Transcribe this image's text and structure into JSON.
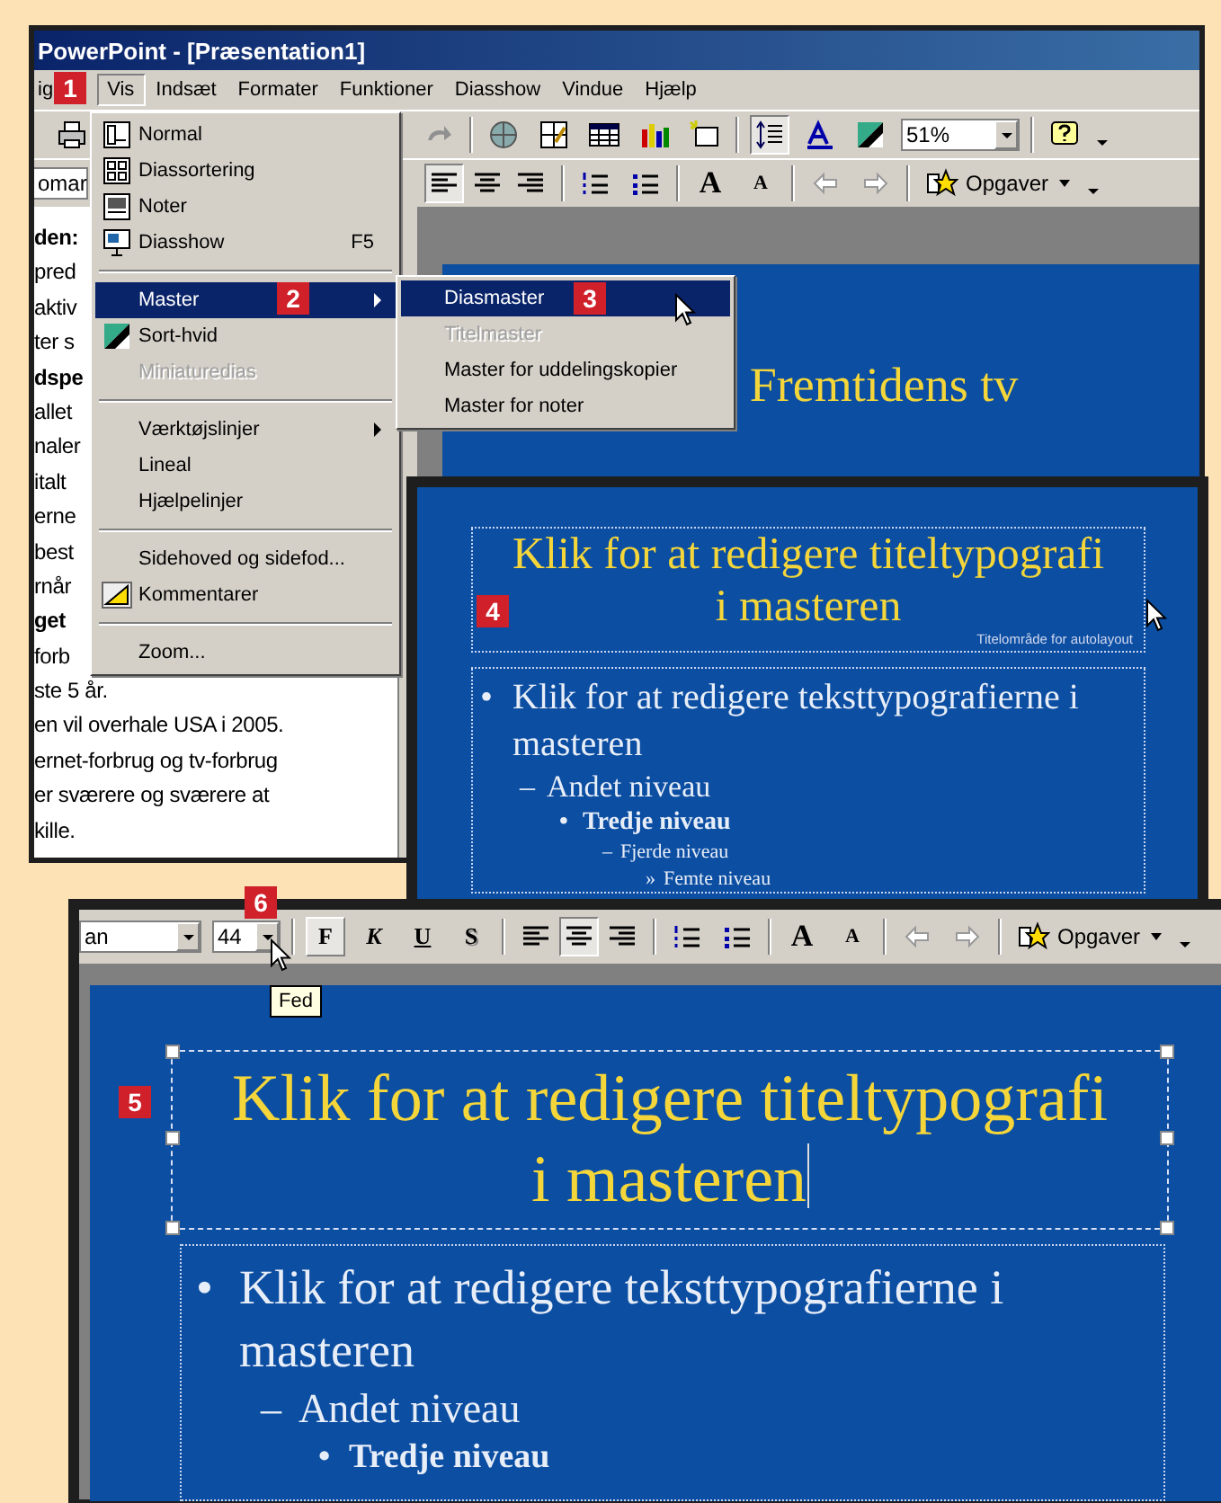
{
  "desktop_window": {
    "title": "PowerPoint - [Præsentation1]",
    "menu_bar": [
      {
        "label": "ig",
        "selected": false
      },
      {
        "label": "Vis",
        "selected": true
      },
      {
        "label": "Indsæt",
        "selected": false
      },
      {
        "label": "Formater",
        "selected": false
      },
      {
        "label": "Funktioner",
        "selected": false
      },
      {
        "label": "Diasshow",
        "selected": false
      },
      {
        "label": "Vindue",
        "selected": false
      },
      {
        "label": "Hjælp",
        "selected": false
      }
    ],
    "standard_toolbar": {
      "zoom": "51%"
    },
    "formatting_toolbar": {
      "font": "omar",
      "alignment": [
        {
          "selected": true
        },
        {
          "selected": false
        },
        {
          "selected": false
        }
      ],
      "grow_font": "A",
      "shrink_font": "A",
      "tasks": "Opgaver"
    },
    "outline_lines": [
      {
        "text": "den:",
        "kind": "bold"
      },
      {
        "text": "pred",
        "kind": "normal"
      },
      {
        "text": "aktiv",
        "kind": "normal"
      },
      {
        "text": "ter s",
        "kind": "normal"
      },
      {
        "text": "dspe",
        "kind": "bold"
      },
      {
        "text": "allet",
        "kind": "normal"
      },
      {
        "text": "naler",
        "kind": "normal"
      },
      {
        "text": "italt",
        "kind": "normal"
      },
      {
        "text": "erne",
        "kind": "normal"
      },
      {
        "text": "best",
        "kind": "normal"
      },
      {
        "text": "rnår",
        "kind": "normal"
      },
      {
        "text": "get",
        "kind": "bold"
      },
      {
        "text": "forb",
        "kind": "normal"
      },
      {
        "text": "ste 5 år.",
        "kind": "normal"
      },
      {
        "text": "en vil overhale USA i 2005.",
        "kind": "normal"
      },
      {
        "text": "ernet-forbrug og tv-forbrug",
        "kind": "normal"
      },
      {
        "text": "er sværere og sværere at",
        "kind": "normal"
      },
      {
        "text": "kille.",
        "kind": "normal"
      }
    ],
    "view_menu": [
      {
        "kind": "item",
        "label": "Normal",
        "selected": false,
        "disabled": false,
        "submenu": false
      },
      {
        "kind": "item",
        "label": "Diassortering",
        "selected": false,
        "disabled": false,
        "submenu": false
      },
      {
        "kind": "item",
        "label": "Noter",
        "selected": false,
        "disabled": false,
        "submenu": false
      },
      {
        "kind": "item",
        "label": "Diasshow",
        "shortcut": "F5",
        "selected": false,
        "disabled": false,
        "submenu": false
      },
      {
        "kind": "separator"
      },
      {
        "kind": "item",
        "label": "Master",
        "selected": true,
        "disabled": false,
        "submenu": true
      },
      {
        "kind": "item",
        "label": "Sort-hvid",
        "selected": false,
        "disabled": false,
        "submenu": false
      },
      {
        "kind": "item",
        "label": "Miniaturedias",
        "selected": false,
        "disabled": true,
        "submenu": false
      },
      {
        "kind": "separator"
      },
      {
        "kind": "item",
        "label": "Værktøjslinjer",
        "selected": false,
        "disabled": false,
        "submenu": true
      },
      {
        "kind": "item",
        "label": "Lineal",
        "selected": false,
        "disabled": false,
        "submenu": false
      },
      {
        "kind": "item",
        "label": "Hjælpelinjer",
        "selected": false,
        "disabled": false,
        "submenu": false
      },
      {
        "kind": "separator"
      },
      {
        "kind": "item",
        "label": "Sidehoved og sidefod...",
        "selected": false,
        "disabled": false,
        "submenu": false
      },
      {
        "kind": "item",
        "label": "Kommentarer",
        "selected": false,
        "disabled": false,
        "submenu": false
      },
      {
        "kind": "separator"
      },
      {
        "kind": "item",
        "label": "Zoom...",
        "selected": false,
        "disabled": false,
        "submenu": false
      }
    ],
    "master_submenu": [
      {
        "label": "Diasmaster",
        "selected": true,
        "disabled": false
      },
      {
        "label": "Titelmaster",
        "selected": false,
        "disabled": true
      },
      {
        "label": "Master for uddelingskopier",
        "selected": false,
        "disabled": false
      },
      {
        "label": "Master for noter",
        "selected": false,
        "disabled": false
      }
    ],
    "slide": {
      "title": "Fremtidens tv"
    }
  },
  "master_view": {
    "title": "Klik for at redigere titeltypografi i masteren",
    "placeholder_label": "Titelområde for autolayout",
    "body": [
      {
        "bullet": "•",
        "text": "Klik for at redigere teksttypografierne i masteren",
        "children": [
          {
            "bullet": "–",
            "text": "Andet niveau",
            "children": [
              {
                "bullet": "•",
                "text": "Tredje niveau",
                "children": [
                  {
                    "bullet": "–",
                    "text": "Fjerde niveau",
                    "children": [
                      {
                        "bullet": "»",
                        "text": "Femte niveau"
                      }
                    ]
                  }
                ]
              }
            ]
          }
        ]
      }
    ]
  },
  "zoomed_window": {
    "formatting_toolbar": {
      "font": "an",
      "size": "44",
      "styles": [
        {
          "label": "F",
          "selected": true
        },
        {
          "label": "K",
          "selected": false
        },
        {
          "label": "U",
          "selected": false
        },
        {
          "label": "S",
          "selected": false
        }
      ],
      "alignment": [
        {
          "selected": false
        },
        {
          "selected": true
        },
        {
          "selected": false
        }
      ],
      "grow_font": "A",
      "shrink_font": "A",
      "tasks": "Opgaver"
    },
    "tooltip": "Fed",
    "slide": {
      "title": "Klik for at redigere titeltypografi i masteren",
      "body": [
        {
          "bullet": "•",
          "text": "Klik for at redigere teksttypografierne i masteren",
          "children": [
            {
              "bullet": "–",
              "text": "Andet niveau",
              "children": [
                {
                  "bullet": "•",
                  "text": "Tredje niveau"
                }
              ]
            }
          ]
        }
      ]
    }
  },
  "callouts": [
    "1",
    "2",
    "3",
    "4",
    "5",
    "6"
  ]
}
